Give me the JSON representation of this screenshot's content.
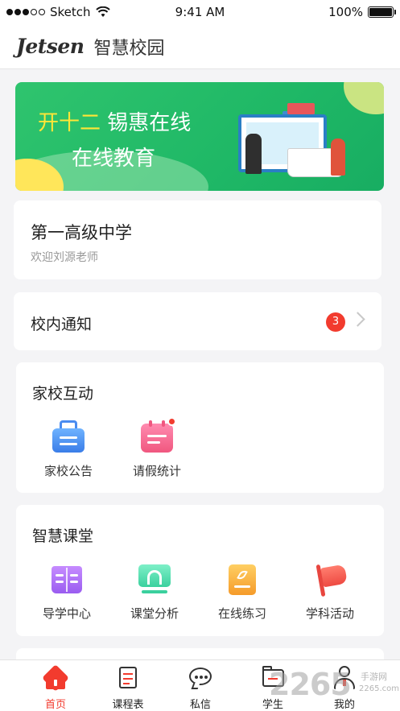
{
  "status_bar": {
    "carrier": "Sketch",
    "time": "9:41 AM",
    "battery": "100%",
    "signal_bars": 5,
    "signal_filled": 3
  },
  "header": {
    "logo_text": "Jetsen",
    "title": "智慧校园"
  },
  "banner": {
    "highlight": "开十二",
    "line1_rest": " 锡惠在线",
    "line2": "在线教育"
  },
  "school": {
    "name": "第一高级中学",
    "welcome": "欢迎刘源老师"
  },
  "notice": {
    "title": "校内通知",
    "badge_count": "3"
  },
  "interaction": {
    "title": "家校互动",
    "items": [
      {
        "label": "家校公告",
        "icon": "announcement-icon"
      },
      {
        "label": "请假统计",
        "icon": "leave-calendar-icon"
      }
    ]
  },
  "classroom": {
    "title": "智慧课堂",
    "items": [
      {
        "label": "导学中心",
        "icon": "guide-book-icon"
      },
      {
        "label": "课堂分析",
        "icon": "classroom-monitor-icon"
      },
      {
        "label": "在线练习",
        "icon": "practice-notebook-icon"
      },
      {
        "label": "学科活动",
        "icon": "flag-icon"
      }
    ]
  },
  "tab_bar": {
    "tabs": [
      {
        "label": "首页",
        "icon": "home-icon",
        "active": true
      },
      {
        "label": "课程表",
        "icon": "schedule-icon",
        "active": false
      },
      {
        "label": "私信",
        "icon": "message-icon",
        "active": false
      },
      {
        "label": "学生",
        "icon": "folder-icon",
        "active": false
      },
      {
        "label": "我的",
        "icon": "profile-icon",
        "active": false
      }
    ]
  },
  "watermark": {
    "big": "2265",
    "small": "手游网",
    "url": "2265.com"
  },
  "colors": {
    "accent_red": "#f23b2e",
    "banner_green": "#2fc46e",
    "banner_yellow": "#ffe637"
  }
}
